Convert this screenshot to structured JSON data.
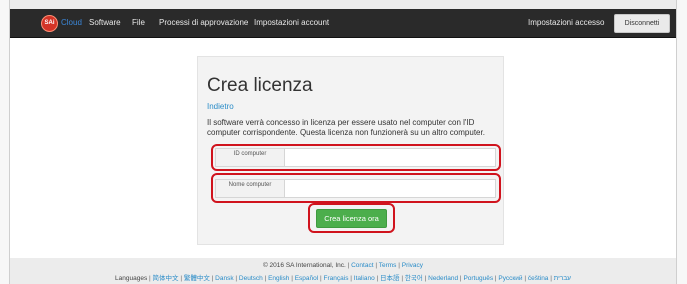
{
  "navbar": {
    "logo_text": "SAi",
    "brand": "Cloud",
    "items": [
      "Software",
      "File",
      "Processi di approvazione",
      "Impostazioni account"
    ],
    "access_settings": "Impostazioni accesso",
    "disconnect": "Disconnetti"
  },
  "panel": {
    "title": "Crea licenza",
    "back": "Indietro",
    "description": "Il software verrà concesso in licenza per essere usato nel computer con l'ID computer corrispondente. Questa licenza non funzionerà su un altro computer.",
    "fields": {
      "computer_id": {
        "label": "ID computer",
        "value": ""
      },
      "computer_name": {
        "label": "Nome computer",
        "value": ""
      }
    },
    "submit": "Crea licenza ora"
  },
  "footer": {
    "copyright": "© 2016 SA International, Inc.",
    "links": [
      "Contact",
      "Terms",
      "Privacy"
    ],
    "languages_label": "Languages",
    "languages": [
      "简体中文",
      "繁體中文",
      "Dansk",
      "Deutsch",
      "English",
      "Español",
      "Français",
      "Italiano",
      "日本語",
      "한국어",
      "Nederland",
      "Português",
      "Русский",
      "čeština",
      "עברית"
    ]
  },
  "colors": {
    "navbar": "#2a2a2a",
    "brand": "#3b87d8",
    "link": "#2a8cc8",
    "primary_button": "#4cae4c",
    "highlight": "#d0131d"
  }
}
